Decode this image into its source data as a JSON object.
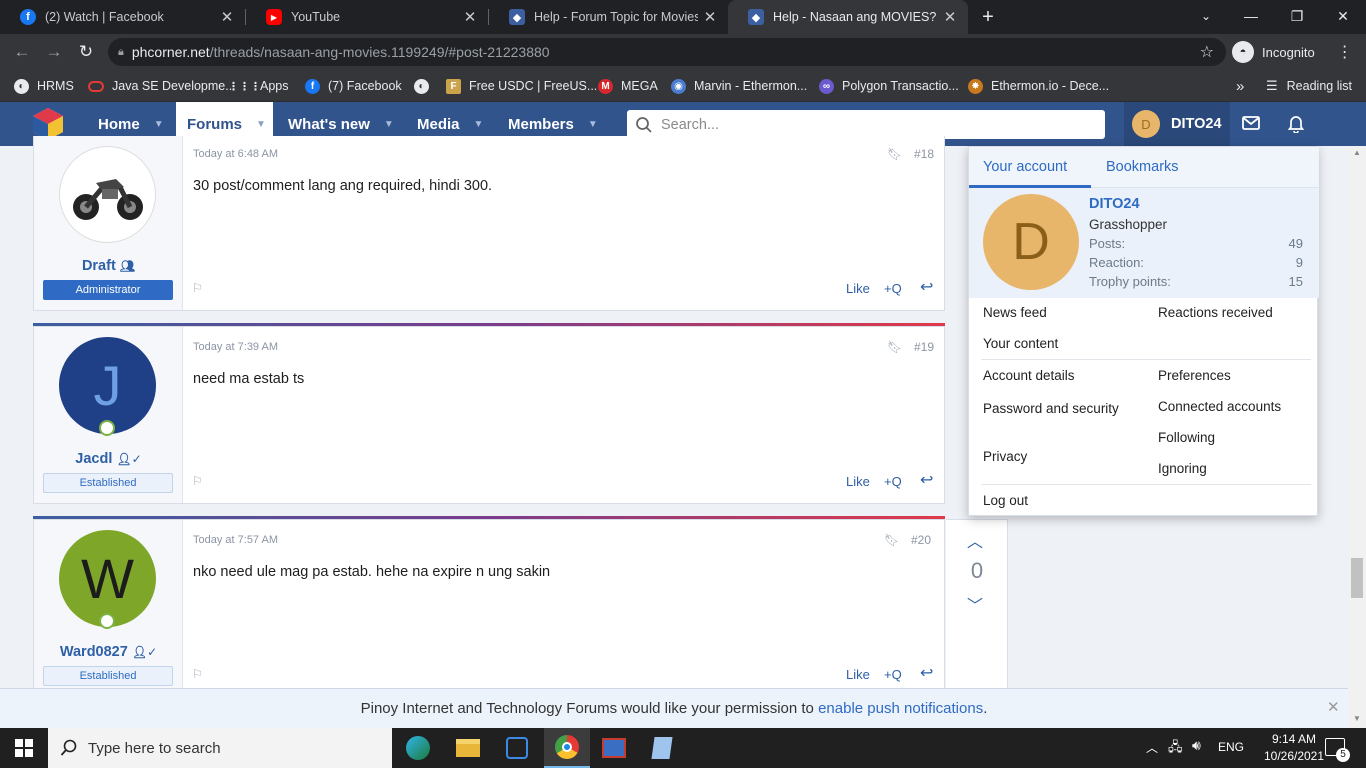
{
  "browser": {
    "tabs": [
      {
        "title": "(2) Watch | Facebook",
        "color": "#1877f2",
        "glyph": "f",
        "active": false
      },
      {
        "title": "YouTube",
        "color": "#ff0000",
        "glyph": "▶",
        "active": false
      },
      {
        "title": "Help - Forum Topic for Movies M",
        "color": "#3b5fa0",
        "glyph": "◆",
        "active": false
      },
      {
        "title": "Help - Nasaan ang MOVIES? | Pin",
        "color": "#3b5fa0",
        "glyph": "◆",
        "active": true
      }
    ],
    "new_tab_icon": "plus-icon",
    "url_host": "phcorner.net",
    "url_path": "/threads/nasaan-ang-movies.1199249/#post-21223880",
    "incognito_label": "Incognito",
    "bookmarks": [
      {
        "label": "HRMS",
        "color": "#5f6368",
        "glyph": "◐"
      },
      {
        "label": "Java SE Developme...",
        "color": "#e53935",
        "glyph": "◯"
      },
      {
        "label": "Apps",
        "color": "#5f6368",
        "glyph": "⋮⋮"
      },
      {
        "label": "(7) Facebook",
        "color": "#1877f2",
        "glyph": "f"
      },
      {
        "label": "",
        "color": "#5f6368",
        "glyph": "◐"
      },
      {
        "label": "Free USDC | FreeUS...",
        "color": "#caa34a",
        "glyph": "F"
      },
      {
        "label": "MEGA",
        "color": "#d9272e",
        "glyph": "M"
      },
      {
        "label": "Marvin - Ethermon...",
        "color": "#4a7cd0",
        "glyph": "◉"
      },
      {
        "label": "Polygon Transactio...",
        "color": "#6a5acd",
        "glyph": "∞"
      },
      {
        "label": "Ethermon.io - Dece...",
        "color": "#c9781e",
        "glyph": "✸"
      }
    ],
    "reading_list": "Reading list"
  },
  "site": {
    "nav": [
      {
        "label": "Home",
        "active": false
      },
      {
        "label": "Forums",
        "active": true
      },
      {
        "label": "What's new",
        "active": false
      },
      {
        "label": "Media",
        "active": false
      },
      {
        "label": "Members",
        "active": false
      }
    ],
    "search_placeholder": "Search...",
    "user": {
      "initial": "D",
      "name": "DITO24"
    }
  },
  "posts": [
    {
      "time": "Today at 6:48 AM",
      "num": "#18",
      "text": "30 post/comment lang ang required, hindi 300.",
      "user": "Draft",
      "badge": "Administrator",
      "avatar_letter": "",
      "avatar_bg": "#ffffff",
      "avatar_color": "#333"
    },
    {
      "time": "Today at 7:39 AM",
      "num": "#19",
      "text": "need ma estab ts",
      "user": "Jacdl",
      "badge": "Established",
      "avatar_letter": "J",
      "avatar_bg": "#1f3f86",
      "avatar_color": "#6fa0e6"
    },
    {
      "time": "Today at 7:57 AM",
      "num": "#20",
      "text": "nko need ule mag pa estab. hehe na expire n ung sakin",
      "user": "Ward0827",
      "badge": "Established",
      "avatar_letter": "W",
      "avatar_bg": "#7ea72a",
      "avatar_color": "#1c1c1c"
    }
  ],
  "post_actions": {
    "like": "Like",
    "quote": "+Q"
  },
  "vote_score": "0",
  "account_menu": {
    "tabs": [
      "Your account",
      "Bookmarks"
    ],
    "name": "DITO24",
    "title": "Grasshopper",
    "initial": "D",
    "stats": [
      {
        "label": "Posts:",
        "value": "49"
      },
      {
        "label": "Reaction:",
        "value": "9"
      },
      {
        "label": "Trophy points:",
        "value": "15"
      }
    ],
    "links_left1": [
      "News feed",
      "Your content"
    ],
    "links_right1": [
      "Reactions received"
    ],
    "links_left2": [
      "Account details",
      "Password and security",
      "Privacy"
    ],
    "links_right2": [
      "Preferences",
      "Connected accounts",
      "Following",
      "Ignoring"
    ],
    "logout": "Log out"
  },
  "notification": {
    "text": "Pinoy Internet and Technology Forums would like your permission to ",
    "link": "enable push notifications",
    "end": "."
  },
  "taskbar": {
    "search_placeholder": "Type here to search",
    "lang": "ENG",
    "time": "9:14 AM",
    "date": "10/26/2021",
    "notif_count": "5"
  }
}
